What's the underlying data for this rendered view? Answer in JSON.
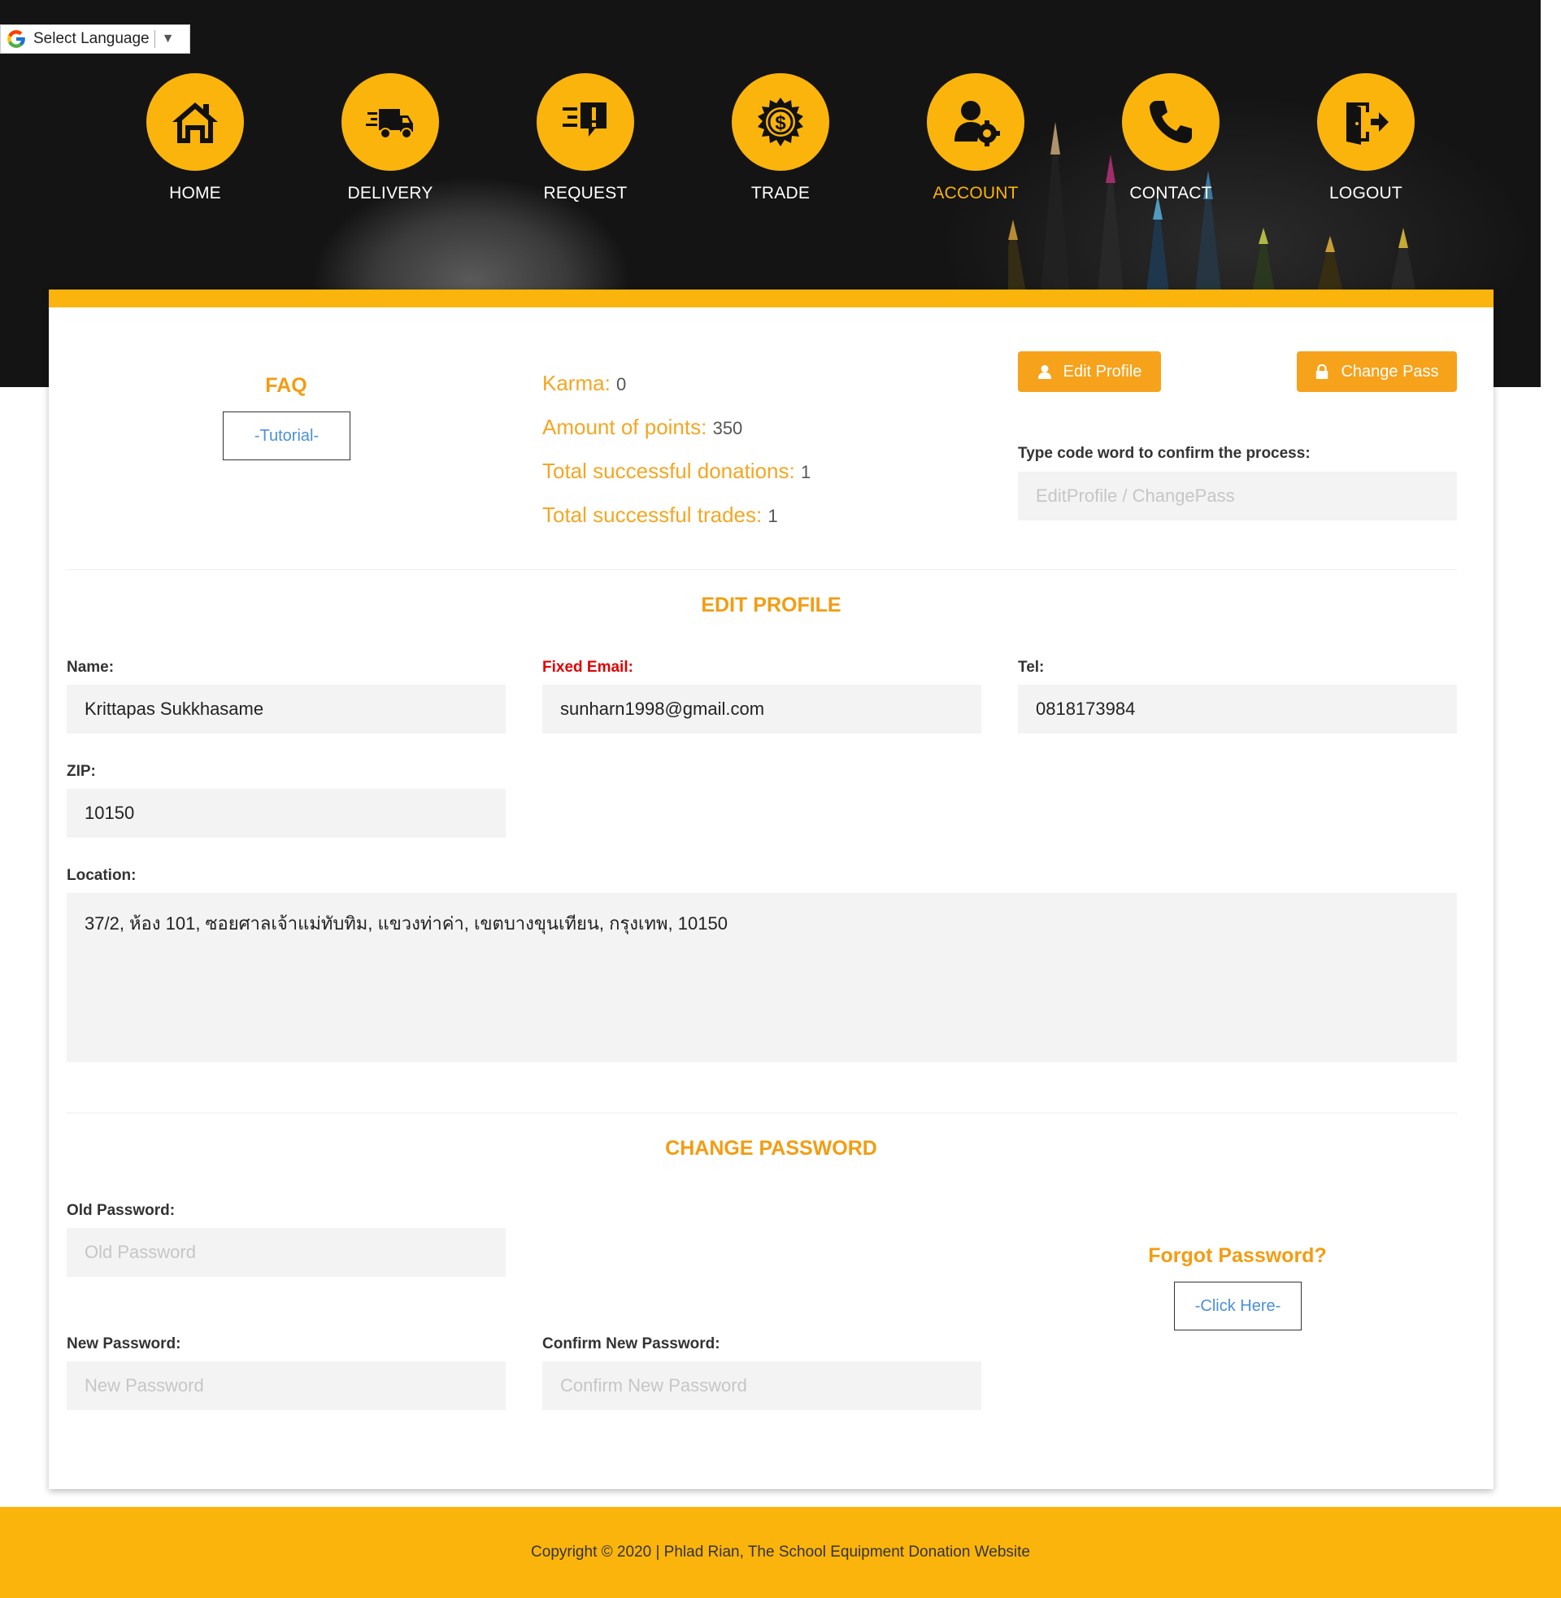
{
  "language_widget": {
    "label": "Select Language",
    "arrow": "▼",
    "icon": "google-g-icon"
  },
  "nav": {
    "items": [
      {
        "label": "HOME",
        "icon": "home-icon",
        "active": false
      },
      {
        "label": "DELIVERY",
        "icon": "delivery-truck-icon",
        "active": false
      },
      {
        "label": "REQUEST",
        "icon": "request-icon",
        "active": false
      },
      {
        "label": "TRADE",
        "icon": "trade-coin-icon",
        "active": false
      },
      {
        "label": "ACCOUNT",
        "icon": "account-settings-icon",
        "active": true
      },
      {
        "label": "CONTACT",
        "icon": "phone-icon",
        "active": false
      },
      {
        "label": "LOGOUT",
        "icon": "logout-door-icon",
        "active": false
      }
    ]
  },
  "faq": {
    "title": "FAQ",
    "button": "-Tutorial-"
  },
  "stats": {
    "karma_label": "Karma:",
    "karma_value": "0",
    "points_label": "Amount of points:",
    "points_value": "350",
    "donations_label": "Total successful donations:",
    "donations_value": "1",
    "trades_label": "Total successful trades:",
    "trades_value": "1"
  },
  "actions": {
    "edit_profile": "Edit Profile",
    "change_pass": "Change Pass",
    "code_label": "Type code word to confirm the process:",
    "code_placeholder": "EditProfile / ChangePass"
  },
  "edit_profile": {
    "title": "EDIT PROFILE",
    "name_label": "Name:",
    "name_value": "Krittapas Sukkhasame",
    "email_label": "Fixed Email:",
    "email_value": "sunharn1998@gmail.com",
    "tel_label": "Tel:",
    "tel_value": "0818173984",
    "zip_label": "ZIP:",
    "zip_value": "10150",
    "location_label": "Location:",
    "location_value": "37/2, ห้อง 101, ซอยศาลเจ้าแม่ทับทิม, แขวงท่าค่า, เขตบางขุนเทียน, กรุงเทพ, 10150"
  },
  "change_password": {
    "title": "CHANGE PASSWORD",
    "old_label": "Old Password:",
    "old_placeholder": "Old Password",
    "new_label": "New Password:",
    "new_placeholder": "New Password",
    "confirm_label": "Confirm New Password:",
    "confirm_placeholder": "Confirm New Password",
    "forgot_title": "Forgot Password?",
    "forgot_button": "-Click Here-"
  },
  "footer": {
    "text": "Copyright © 2020 | Phlad Rian, The School Equipment Donation Website"
  },
  "colors": {
    "accent": "#fbb40b",
    "heading": "#f39c12",
    "button": "#f7a21b",
    "link": "#4a90d9",
    "error": "#e00000"
  }
}
